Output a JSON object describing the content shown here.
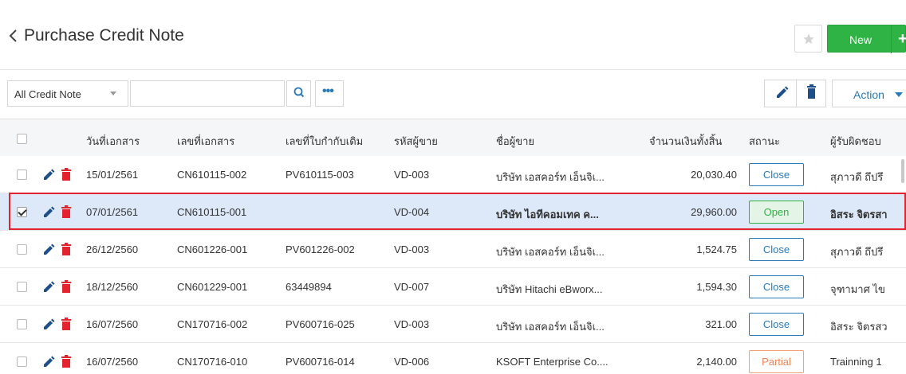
{
  "header": {
    "title": "Purchase Credit Note",
    "new_label": "New",
    "plus_label": "+"
  },
  "toolbar": {
    "filter_value": "All Credit Note",
    "search_value": "",
    "more_label": "•••",
    "action_label": "Action"
  },
  "table": {
    "columns": [
      "วันที่เอกสาร",
      "เลขที่เอกสาร",
      "เลขที่ใบกำกับเดิม",
      "รหัสผู้ขาย",
      "ชื่อผู้ขาย",
      "จำนวนเงินทั้งสิ้น",
      "สถานะ",
      "ผู้รับผิดชอบ"
    ],
    "rows": [
      {
        "date": "15/01/2561",
        "doc_no": "CN610115-002",
        "ref_no": "PV610115-003",
        "vendor_code": "VD-003",
        "vendor_name": "บริษัท เอสคอร์ท เอ็นจิเ...",
        "amount": "20,030.40",
        "status": "Close",
        "owner": "สุภาวดี ถึปรึ",
        "selected": false
      },
      {
        "date": "07/01/2561",
        "doc_no": "CN610115-001",
        "ref_no": "",
        "vendor_code": "VD-004",
        "vendor_name": "บริษัท ไอทีคอมเทค ค...",
        "amount": "29,960.00",
        "status": "Open",
        "owner": "อิสระ จิตรสา",
        "selected": true
      },
      {
        "date": "26/12/2560",
        "doc_no": "CN601226-001",
        "ref_no": "PV601226-002",
        "vendor_code": "VD-003",
        "vendor_name": "บริษัท เอสคอร์ท เอ็นจิเ...",
        "amount": "1,524.75",
        "status": "Close",
        "owner": "สุภาวดี ถึปรึ",
        "selected": false
      },
      {
        "date": "18/12/2560",
        "doc_no": "CN601229-001",
        "ref_no": "63449894",
        "vendor_code": "VD-007",
        "vendor_name": "บริษัท Hitachi eBworx...",
        "amount": "1,594.30",
        "status": "Close",
        "owner": "จุฑามาศ ไข",
        "selected": false
      },
      {
        "date": "16/07/2560",
        "doc_no": "CN170716-002",
        "ref_no": "PV600716-025",
        "vendor_code": "VD-003",
        "vendor_name": "บริษัท เอสคอร์ท เอ็นจิเ...",
        "amount": "321.00",
        "status": "Close",
        "owner": "อิสระ จิตรสว",
        "selected": false
      },
      {
        "date": "16/07/2560",
        "doc_no": "CN170716-010",
        "ref_no": "PV600716-014",
        "vendor_code": "VD-006",
        "vendor_name": "KSOFT Enterprise Co....",
        "amount": "2,140.00",
        "status": "Partial",
        "owner": "Trainning 1",
        "selected": false
      }
    ]
  },
  "colors": {
    "accent_blue": "#2a7ab8",
    "new_green": "#2fb344",
    "delete_red": "#e3232d",
    "selection_outline": "#e3232d",
    "selected_row_bg": "#dde8f8"
  },
  "icons": {
    "back": "chevron-left-icon",
    "star": "star-icon",
    "search": "search-icon",
    "edit": "pencil-icon",
    "delete": "trash-icon",
    "more": "ellipsis-icon"
  }
}
